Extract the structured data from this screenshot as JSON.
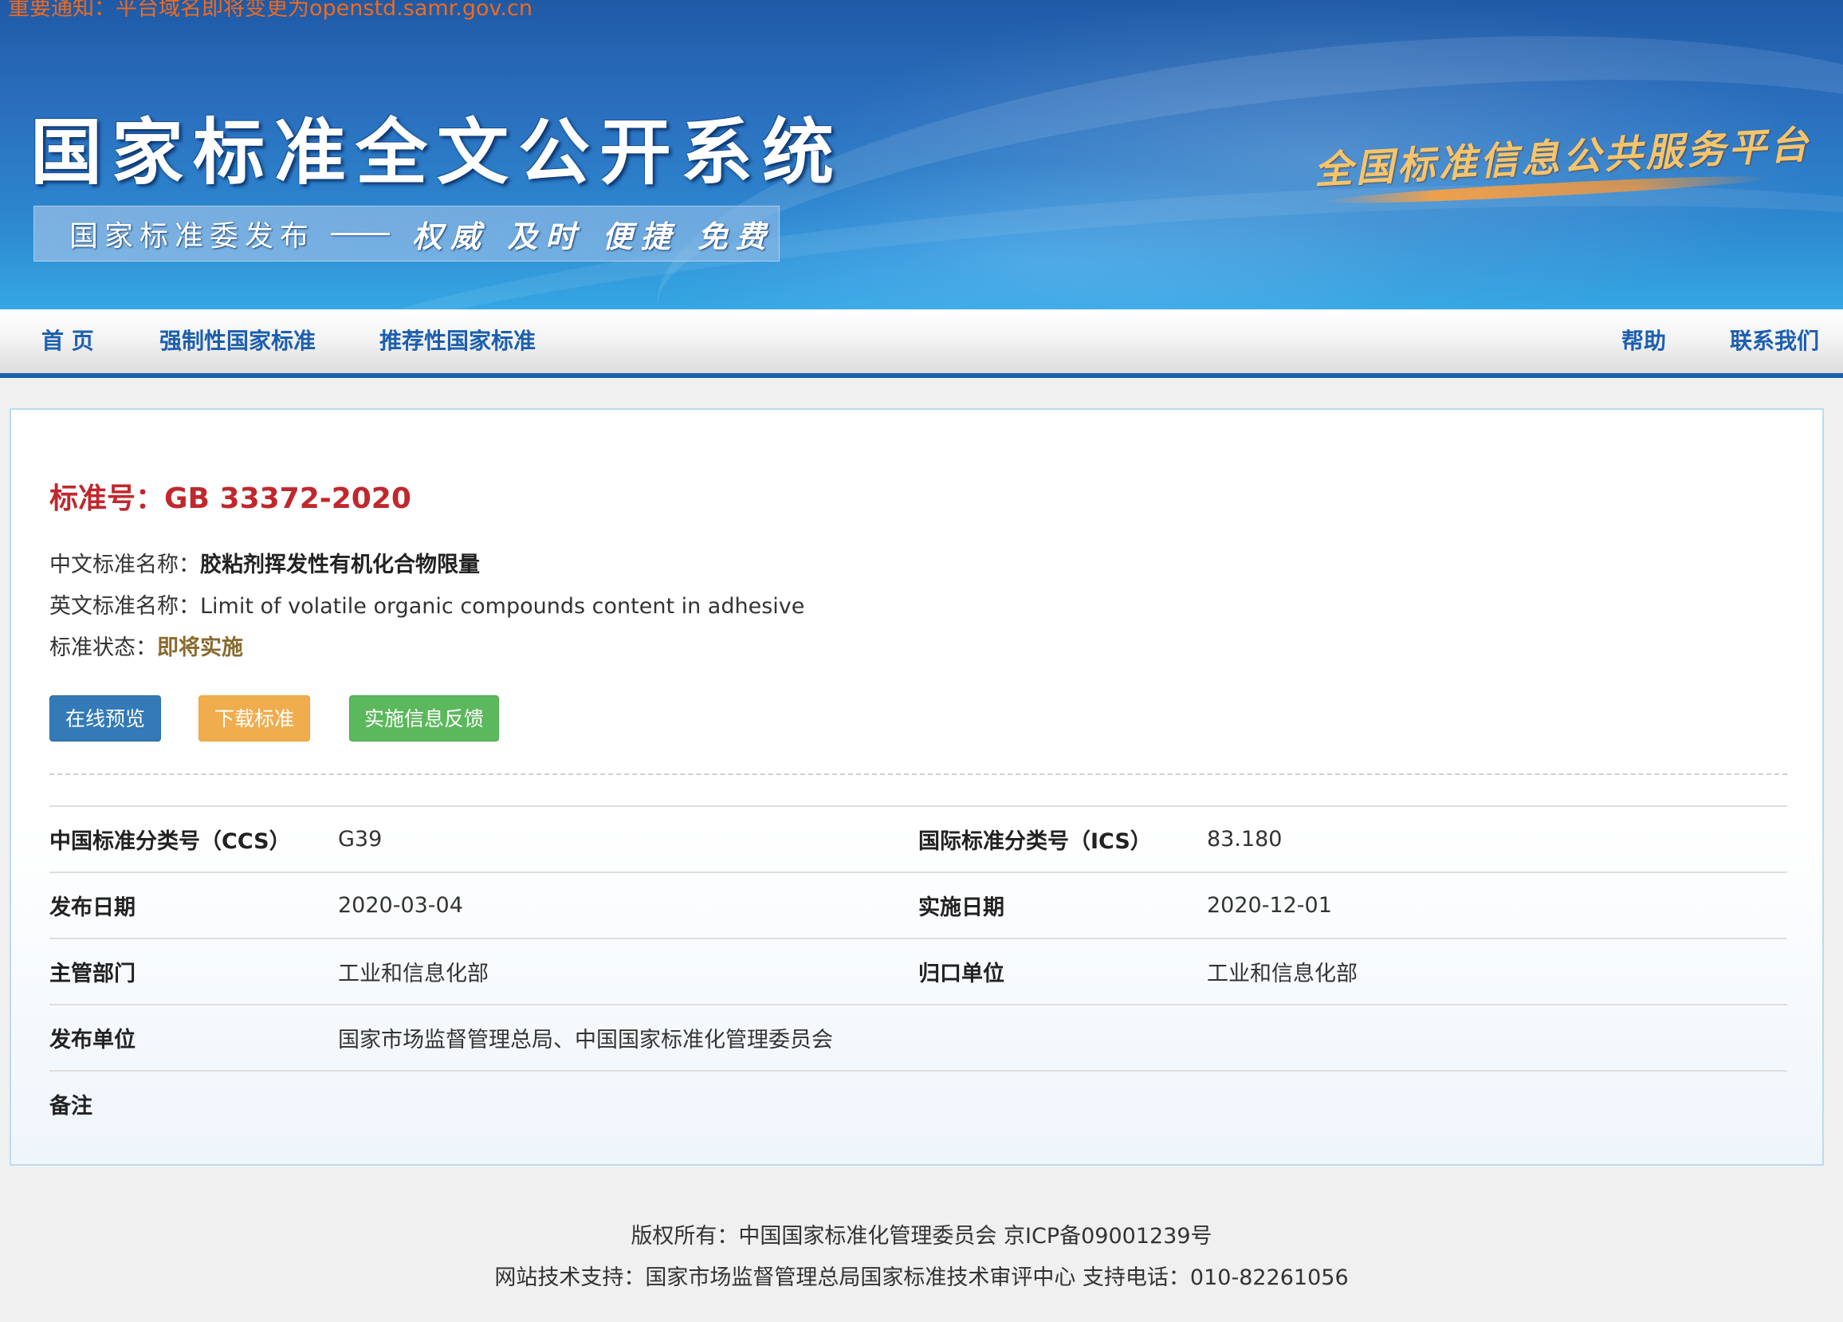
{
  "banner": {
    "notice": "重要通知：平台域名即将变更为openstd.samr.gov.cn",
    "site_title": "国家标准全文公开系统",
    "slogan_left": "国家标准委发布",
    "slogan_right": "权威 及时 便捷 免费",
    "platform_logo": "全国标准信息公共服务平台"
  },
  "nav": {
    "home": "首 页",
    "mandatory": "强制性国家标准",
    "recommended": "推荐性国家标准",
    "help": "帮助",
    "contact": "联系我们"
  },
  "standard": {
    "title": "标准号：GB 33372-2020",
    "cn_name_label": "中文标准名称：",
    "cn_name": "胶粘剂挥发性有机化合物限量",
    "en_name_label": "英文标准名称：",
    "en_name": "Limit of volatile organic compounds content in adhesive",
    "status_label": "标准状态：",
    "status": "即将实施"
  },
  "buttons": {
    "preview": "在线预览",
    "download": "下载标准",
    "feedback": "实施信息反馈"
  },
  "details": {
    "ccs_label": "中国标准分类号（CCS）",
    "ccs_value": "G39",
    "ics_label": "国际标准分类号（ICS）",
    "ics_value": "83.180",
    "publish_date_label": "发布日期",
    "publish_date": "2020-03-04",
    "implement_date_label": "实施日期",
    "implement_date": "2020-12-01",
    "department_label": "主管部门",
    "department": "工业和信息化部",
    "affiliation_label": "归口单位",
    "affiliation": "工业和信息化部",
    "publisher_label": "发布单位",
    "publisher": "国家市场监督管理总局、中国国家标准化管理委员会",
    "remarks_label": "备注",
    "remarks": ""
  },
  "footer": {
    "copyright": "版权所有：中国国家标准化管理委员会 京ICP备09001239号",
    "support": "网站技术支持：国家市场监督管理总局国家标准技术审评中心 支持电话：010-82261056"
  },
  "colors": {
    "nav_text": "#1c5fae",
    "title_red": "#c0282d",
    "status_brown": "#8a6a2e",
    "btn_blue": "#337ab7",
    "btn_orange": "#f0ad4e",
    "btn_green": "#5cb85c"
  }
}
